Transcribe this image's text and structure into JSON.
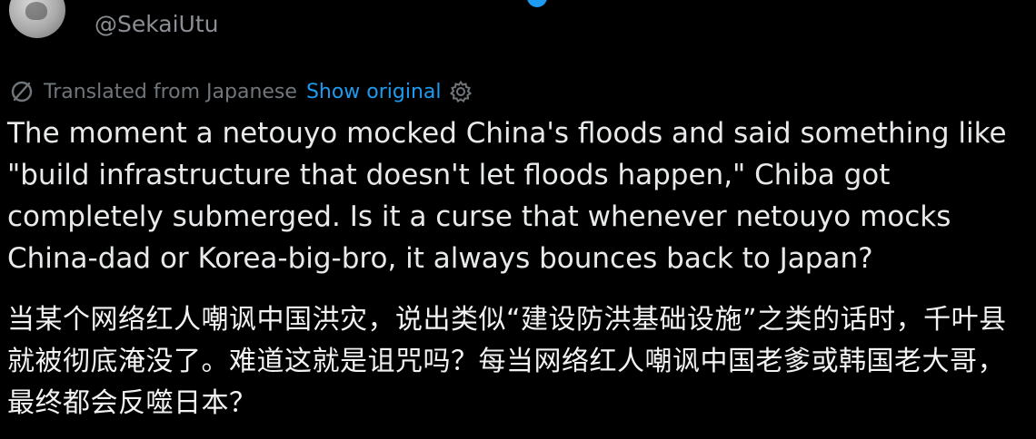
{
  "user": {
    "display_name": "",
    "handle": "@SekaiUtu"
  },
  "translation_bar": {
    "icon": "translate-icon",
    "label": "Translated from Japanese",
    "show_original_label": "Show original",
    "settings_icon": "gear-icon"
  },
  "tweet": {
    "text_en": "The moment a netouyo mocked China's floods and said something like \"build infrastructure that doesn't let floods happen,\" Chiba got completely submerged. Is it a curse that whenever netouyo mocks China-dad or Korea-big-bro, it always bounces back to Japan?",
    "text_zh": "当某个网络红人嘲讽中国洪灾，说出类似“建设防洪基础设施”之类的话时，千叶县就被彻底淹没了。难道这就是诅咒吗？每当网络红人嘲讽中国老爹或韩国老大哥，最终都会反噬日本？"
  },
  "colors": {
    "background": "#000000",
    "text_primary": "#e7e9ea",
    "text_secondary": "#71767b",
    "link": "#1d9bf0"
  }
}
